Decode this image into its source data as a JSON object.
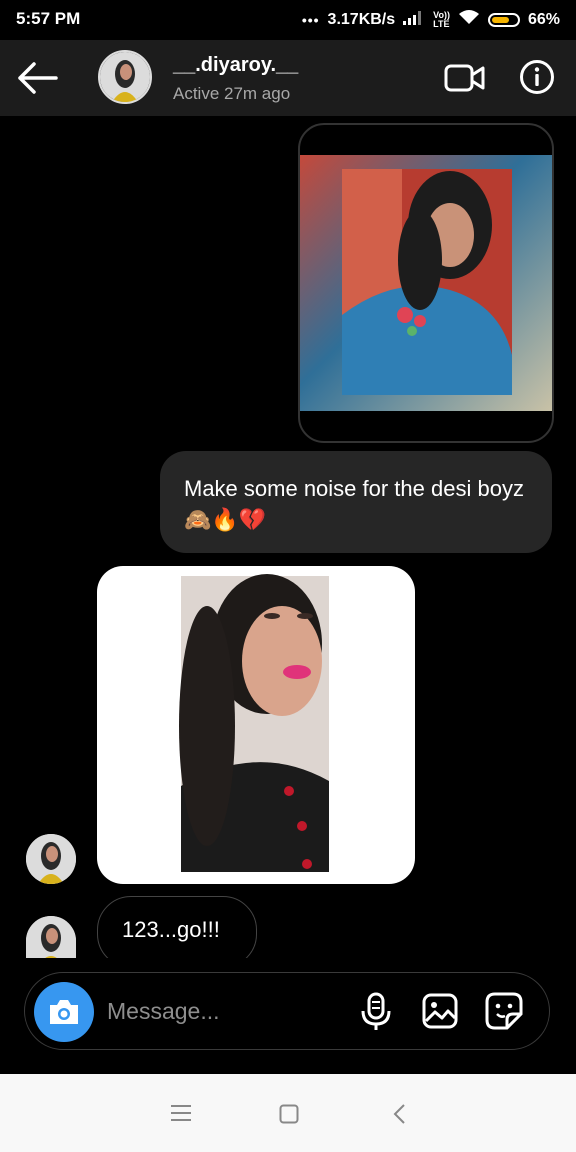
{
  "status_bar": {
    "time": "5:57 PM",
    "speed": "3.17KB/s",
    "dots": "•••",
    "net_label_top": "Vo))",
    "net_label_bottom": "LTE",
    "battery": "66%"
  },
  "header": {
    "username": "__.diyaroy.__",
    "active_status": "Active 27m ago"
  },
  "messages": [
    {
      "type": "image",
      "sender": "me"
    },
    {
      "type": "text",
      "sender": "me",
      "text": "Make some noise for the desi boyz🙈🔥💔"
    },
    {
      "type": "image",
      "sender": "them"
    },
    {
      "type": "text",
      "sender": "them",
      "text": "123...go!!!"
    }
  ],
  "composer": {
    "placeholder": "Message..."
  },
  "colors": {
    "accent_blue": "#3797f0",
    "bubble_bg": "#262626",
    "header_bg": "#1c1c1c",
    "battery_fill": "#f5b400"
  },
  "icons": [
    "back-arrow-icon",
    "video-call-icon",
    "info-icon",
    "camera-icon",
    "microphone-icon",
    "gallery-icon",
    "sticker-icon",
    "menu-icon",
    "home-icon",
    "back-icon"
  ]
}
